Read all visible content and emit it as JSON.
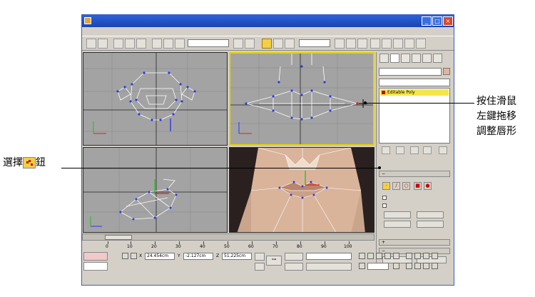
{
  "window": {
    "title": "",
    "controls": {
      "minimize": "_",
      "maximize": "□",
      "close": "×"
    }
  },
  "menu": [
    "",
    "",
    "",
    "",
    "",
    "",
    "",
    "",
    "",
    "",
    "",
    "",
    "",
    "",
    "",
    ""
  ],
  "toolbar": {
    "selection_filter": "",
    "ref_coord": ""
  },
  "viewports": {
    "top": "",
    "front": "",
    "left": "",
    "perspective": ""
  },
  "command_panel": {
    "object_name": "",
    "modifier_list": "",
    "stack_item": "Editable Poly",
    "color": "#e2b59a",
    "selection_rollout": "",
    "check_by_vertex": "",
    "check_ignore_backfacing": "",
    "btn_shrink": "",
    "btn_grow": "",
    "btn_ring": "",
    "btn_loop": "",
    "selected_text": "",
    "soft_selection": "",
    "edit_vertices": "",
    "btn_remove": "",
    "btn_break": "",
    "btn_extrude": "",
    "btn_weld": ""
  },
  "timeline": {
    "slider": "",
    "ticks": [
      "0",
      "10",
      "20",
      "30",
      "40",
      "50",
      "60",
      "70",
      "80",
      "90",
      "100"
    ]
  },
  "status": {
    "lock": "",
    "x_label": "X",
    "x_value": "24.454cm",
    "y_label": "Y",
    "y_value": "-2.127cm",
    "z_label": "Z",
    "z_value": "51.225cm",
    "grid_label": "",
    "prompt": "",
    "auto_key": "",
    "set_key": "",
    "selected_dd": "",
    "key_filters": "",
    "frame": ""
  },
  "callouts": {
    "right_lines": [
      "按住滑鼠",
      "左鍵拖移",
      "調整唇形"
    ],
    "left_before": "選擇",
    "left_after": "鈕"
  }
}
